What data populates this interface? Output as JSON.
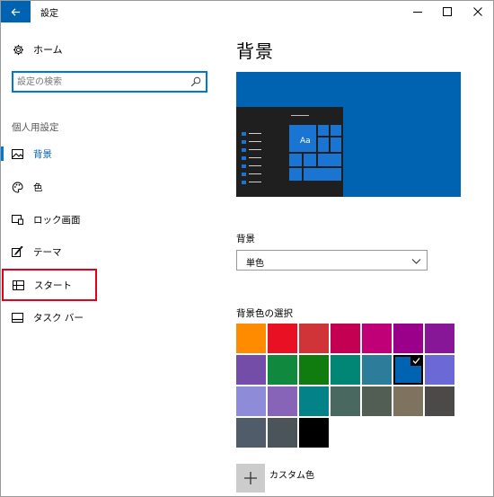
{
  "window": {
    "title": "設定"
  },
  "sidebar": {
    "home_label": "ホーム",
    "search_placeholder": "設定の検索",
    "section_title": "個人用設定",
    "items": [
      {
        "label": "背景",
        "icon": "picture-icon",
        "active": true
      },
      {
        "label": "色",
        "icon": "palette-icon",
        "active": false
      },
      {
        "label": "ロック画面",
        "icon": "lock-screen-icon",
        "active": false
      },
      {
        "label": "テーマ",
        "icon": "theme-icon",
        "active": false
      },
      {
        "label": "スタート",
        "icon": "start-icon",
        "active": false,
        "highlighted": true
      },
      {
        "label": "タスク バー",
        "icon": "taskbar-icon",
        "active": false
      }
    ]
  },
  "main": {
    "title": "背景",
    "preview": {
      "tile_text": "Aa"
    },
    "background_label": "背景",
    "background_value": "単色",
    "color_label": "背景色の選択",
    "custom_color_label": "カスタム色"
  },
  "swatch_colors": [
    "#ff8c00",
    "#e81123",
    "#d13438",
    "#c30052",
    "#bf0077",
    "#9a0089",
    "#881798",
    "#744da9",
    "#10893e",
    "#107c10",
    "#018574",
    "#2d7d9a",
    "#0063b1",
    "#6b69d6",
    "#8e8cd8",
    "#8764b8",
    "#038387",
    "#486860",
    "#525e54",
    "#7e735f",
    "#4c4a48",
    "#515c6b",
    "#4a5459",
    "#000000"
  ],
  "selected_swatch": 12,
  "colors": {
    "accent": "#0078d7",
    "back_button": "#0063b1",
    "highlight_border": "#e3001b"
  }
}
